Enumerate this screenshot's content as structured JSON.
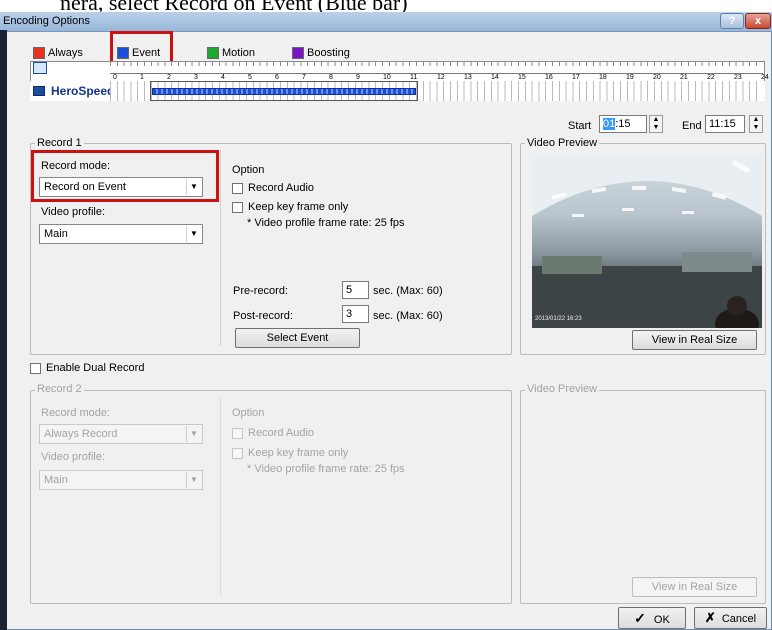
{
  "caption": "nera, select Record on Event (Blue bar)",
  "window": {
    "title": "Encoding Options",
    "help": "?",
    "close": "x"
  },
  "legend": [
    {
      "label": "Always",
      "color": "#e8321e"
    },
    {
      "label": "Event",
      "color": "#1a4fd6"
    },
    {
      "label": "Motion",
      "color": "#1ea82e"
    },
    {
      "label": "Boosting",
      "color": "#7a16c8"
    }
  ],
  "schedule": {
    "hours": [
      "0",
      "1",
      "2",
      "3",
      "4",
      "5",
      "6",
      "7",
      "8",
      "9",
      "10",
      "11",
      "12",
      "13",
      "14",
      "15",
      "16",
      "17",
      "18",
      "19",
      "20",
      "21",
      "22",
      "23",
      "24"
    ],
    "camera": "HeroSpeed"
  },
  "time": {
    "start_label": "Start",
    "start_hh": "01",
    "start_mm": ":15",
    "end_label": "End",
    "end_value": "11:15"
  },
  "record1": {
    "title": "Record 1",
    "mode_label": "Record mode:",
    "mode_value": "Record on Event",
    "profile_label": "Video profile:",
    "profile_value": "Main",
    "option_label": "Option",
    "record_audio": "Record Audio",
    "keyframe": "Keep key frame only",
    "fps_note": "* Video profile frame rate: 25 fps",
    "pre_label": "Pre-record:",
    "pre_value": "5",
    "post_label": "Post-record:",
    "post_value": "3",
    "sec_max": "sec. (Max: 60)",
    "select_event": "Select Event"
  },
  "preview1": {
    "title": "Video Preview",
    "button": "View in Real Size",
    "timestamp": "2013/01/22 16:23"
  },
  "dual_record": "Enable Dual Record",
  "record2": {
    "title": "Record 2",
    "mode_label": "Record mode:",
    "mode_value": "Always Record",
    "profile_label": "Video profile:",
    "profile_value": "Main",
    "option_label": "Option",
    "record_audio": "Record Audio",
    "keyframe": "Keep key frame only",
    "fps_note": "* Video profile frame rate: 25 fps"
  },
  "preview2": {
    "title": "Video Preview",
    "button": "View in Real Size"
  },
  "footer": {
    "ok": "OK",
    "cancel": "Cancel"
  }
}
